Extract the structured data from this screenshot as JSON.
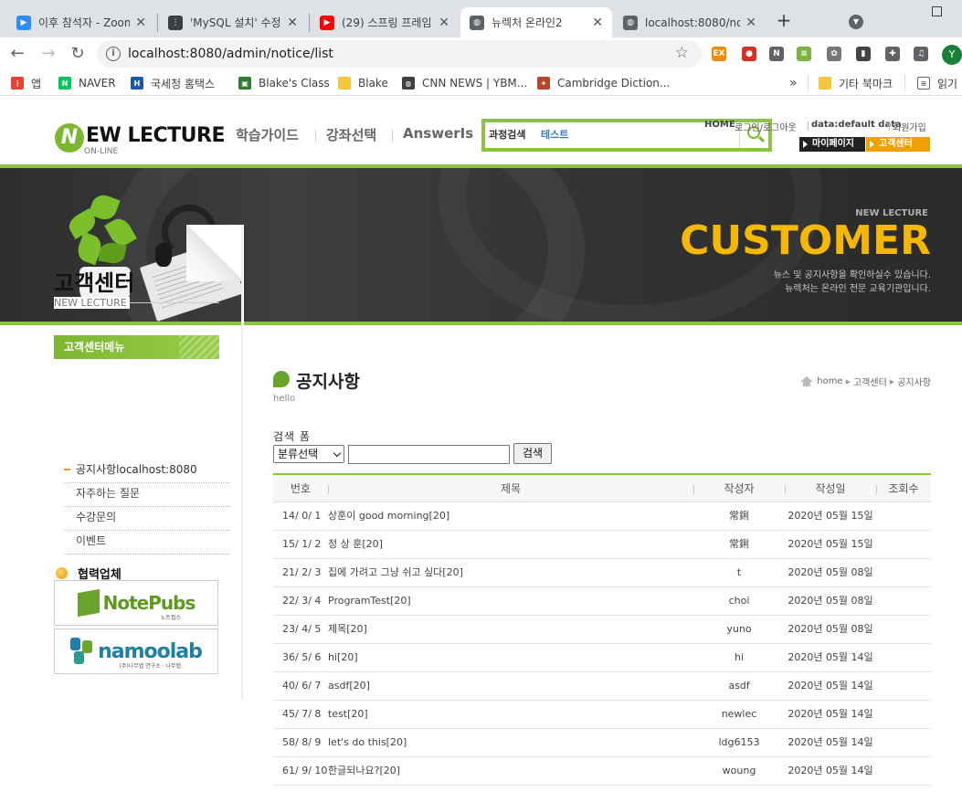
{
  "browser": {
    "tabs": [
      {
        "label": "이후 참석자 - Zoom",
        "favicon_color": "#2d8cff",
        "favicon": "▶"
      },
      {
        "label": "'MySQL 설치' 수정",
        "favicon_color": "#3c4043",
        "favicon": "⋮"
      },
      {
        "label": "(29) 스프링 프레임",
        "favicon_color": "#ff0000",
        "favicon": "▶"
      },
      {
        "label": "뉴렉처 온라인2",
        "favicon_color": "#5f6368",
        "favicon": "◍"
      },
      {
        "label": "localhost:8080/no",
        "favicon_color": "#5f6368",
        "favicon": "◍"
      }
    ],
    "close_glyph": "✕",
    "new_tab": "+",
    "url": "localhost:8080/admin/notice/list",
    "profile_initial": "Y",
    "extensions": [
      {
        "name": "ex-extension-icon",
        "color": "#f08a00",
        "glyph": "EX"
      },
      {
        "name": "red-extension-icon",
        "color": "#d93025",
        "glyph": "●"
      },
      {
        "name": "n-extension-icon",
        "color": "#5f6368",
        "glyph": "N"
      },
      {
        "name": "sheet-extension-icon",
        "color": "#7cb342",
        "glyph": "≡"
      },
      {
        "name": "gear-extension-icon",
        "color": "#777777",
        "glyph": "✿"
      },
      {
        "name": "barcode-extension-icon",
        "color": "#444444",
        "glyph": "▮"
      },
      {
        "name": "puzzle-icon",
        "color": "#5f6368",
        "glyph": "✚"
      },
      {
        "name": "media-icon",
        "color": "#5f6368",
        "glyph": "♫"
      }
    ],
    "bookmarks": [
      {
        "label": "앱",
        "icon_color": "#ea4335",
        "glyph": "⋮"
      },
      {
        "label": "NAVER",
        "icon_color": "#03c75a",
        "glyph": "N"
      },
      {
        "label": "국세청 홈택스",
        "icon_color": "#1a5aa8",
        "glyph": "H"
      },
      {
        "label": "Blake's Class",
        "icon_color": "#2e7d32",
        "glyph": "▣"
      },
      {
        "label": "Blake",
        "icon_color": "#f5c542",
        "glyph": ""
      },
      {
        "label": "CNN NEWS | YBM...",
        "icon_color": "#3c4043",
        "glyph": "◍"
      },
      {
        "label": "Cambridge Diction...",
        "icon_color": "#b5462a",
        "glyph": "✦"
      }
    ],
    "bookmarks_overflow": "»",
    "other_bookmarks": "기타 북마크",
    "reading_list": "읽기"
  },
  "site": {
    "logo_letter": "N",
    "logo_brand": "EW LECTURE",
    "logo_sub": "ON-LINE",
    "gnav": [
      "학습가이드",
      "강좌선택",
      "AnswerIs"
    ],
    "search": {
      "label": "과정검색",
      "value": "테스트"
    },
    "util_links": [
      "HOME",
      "로그인/로그아웃",
      "data:default data",
      "회원가입"
    ],
    "quick": [
      {
        "label": "마이페이지",
        "color": "#222222"
      },
      {
        "label": "고객센터",
        "color": "#f0a000"
      }
    ],
    "visual": {
      "small": "NEW LECTURE",
      "big": "CUSTOMER",
      "desc1": "뉴스 및 공지사항을 확인하실수 있습니다.",
      "desc2": "뉴렉처는 온라인 전문 교육기관입니다."
    },
    "accent": "#8cc43f"
  },
  "aside": {
    "title": "고객센터",
    "subtitle": "NEW LECTURE",
    "menu_title": "고객센터메뉴",
    "menu": [
      {
        "label": "공지사항localhost:8080",
        "active": true
      },
      {
        "label": "자주하는 질문",
        "active": false
      },
      {
        "label": "수강문의",
        "active": false
      },
      {
        "label": "이벤트",
        "active": false
      }
    ],
    "partner_title": "협력업체",
    "partners": [
      {
        "name": "NotePubs",
        "caption": "노트펍스"
      },
      {
        "name": "namoolab",
        "caption": "(주)나무랩 연구소 · 나무랩"
      }
    ]
  },
  "main": {
    "title": "공지사항",
    "subtitle": "hello",
    "breadcrumb": [
      "home",
      "고객센터",
      "공지사항"
    ],
    "search_form": {
      "label": "검색 폼",
      "select_value": "분류선택",
      "input_value": "",
      "button": "검색"
    },
    "table": {
      "headers": [
        "번호",
        "제목",
        "작성자",
        "작성일",
        "조회수"
      ],
      "rows": [
        {
          "no": "14/ 0/ 1",
          "title": "상훈이 good morning[20]",
          "writer": "常鋓",
          "date": "2020년 05월 15일",
          "hit": ""
        },
        {
          "no": "15/ 1/ 2",
          "title": "정 상 훈[20]",
          "writer": "常鋓",
          "date": "2020년 05월 15일",
          "hit": ""
        },
        {
          "no": "21/ 2/ 3",
          "title": "집에 가려고 그냥 쉬고 싶다[20]",
          "writer": "t",
          "date": "2020년 05월 08일",
          "hit": ""
        },
        {
          "no": "22/ 3/ 4",
          "title": "ProgramTest[20]",
          "writer": "choi",
          "date": "2020년 05월 08일",
          "hit": ""
        },
        {
          "no": "23/ 4/ 5",
          "title": "제목[20]",
          "writer": "yuno",
          "date": "2020년 05월 08일",
          "hit": ""
        },
        {
          "no": "36/ 5/ 6",
          "title": "hi[20]",
          "writer": "hi",
          "date": "2020년 05월 14일",
          "hit": ""
        },
        {
          "no": "40/ 6/ 7",
          "title": "asdf[20]",
          "writer": "asdf",
          "date": "2020년 05월 14일",
          "hit": ""
        },
        {
          "no": "45/ 7/ 8",
          "title": "test[20]",
          "writer": "newlec",
          "date": "2020년 05월 14일",
          "hit": ""
        },
        {
          "no": "58/ 8/ 9",
          "title": "let's do this[20]",
          "writer": "ldg6153",
          "date": "2020년 05월 14일",
          "hit": ""
        },
        {
          "no": "61/ 9/ 10",
          "title": "한글되나요?[20]",
          "writer": "woung",
          "date": "2020년 05월 14일",
          "hit": ""
        }
      ]
    }
  }
}
